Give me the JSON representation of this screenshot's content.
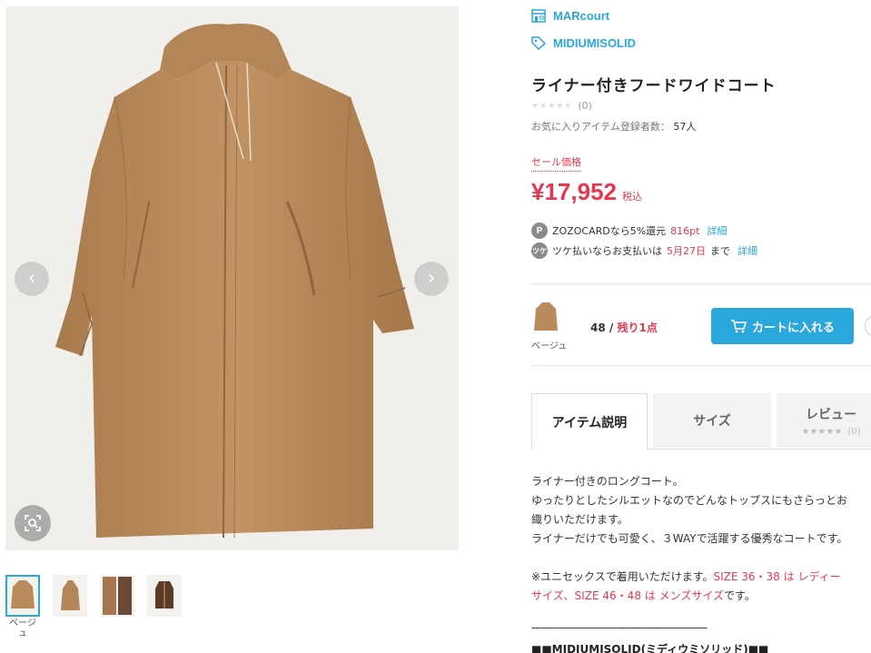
{
  "brands": {
    "shop": "MARcourt",
    "brand": "MIDIUMISOLID"
  },
  "product": {
    "title": "ライナー付きフードワイドコート",
    "rating_stars": "★★★★★",
    "review_count": "(0)",
    "favorite_label": "お気に入りアイテム登録者数：",
    "favorite_count": "57人",
    "sale_label": "セール価格",
    "price": "¥17,952",
    "tax_label": "税込"
  },
  "points": {
    "zozocard_icon": "P",
    "zozocard_text": "ZOZOCARDなら5%還元",
    "zozocard_points": "816pt",
    "zozocard_link": "詳細",
    "tsuke_icon": "ツケ",
    "tsuke_text": "ツケ払いならお支払いは",
    "tsuke_date": "5月27日",
    "tsuke_suffix": "まで",
    "tsuke_link": "詳細"
  },
  "variant": {
    "color": "ベージュ",
    "size": "48",
    "separator": "/",
    "remaining": "残り1点"
  },
  "cart": {
    "label": "カートに入れる"
  },
  "tabs": {
    "description": "アイテム説明",
    "size": "サイズ",
    "review": "レビュー",
    "review_stars": "★★★★★",
    "review_count": "(0)"
  },
  "description": {
    "line1": "ライナー付きのロングコート。",
    "line2": "ゆったりとしたシルエットなのでどんなトップスにもさらっとお",
    "line3": "織りいただけます。",
    "line4": "ライナーだけでも可愛く、３WAYで活躍する優秀なコートです。",
    "line5_a": "※ユニセックスで着用いただけます。",
    "line5_b": "SIZE 36・38 は レディー",
    "line6_a": "サイズ、SIZE 46・48 は メンズサイズ",
    "line6_b": "です。",
    "dashes": "----------------------------------------------------------",
    "brand_heading": "■■MIDIUMISOLID(ミディウミソリッド)■■"
  },
  "thumbnails": {
    "first_label": "ベージュ"
  },
  "colors": {
    "accent": "#2aa7dc",
    "sale": "#e8384f",
    "coat": "#b98c5e"
  },
  "icons": {
    "prev": "chevron-left-icon",
    "next": "chevron-right-icon",
    "zoom": "zoom-icon",
    "shop": "shop-icon",
    "tag": "tag-icon",
    "cart": "cart-icon"
  }
}
